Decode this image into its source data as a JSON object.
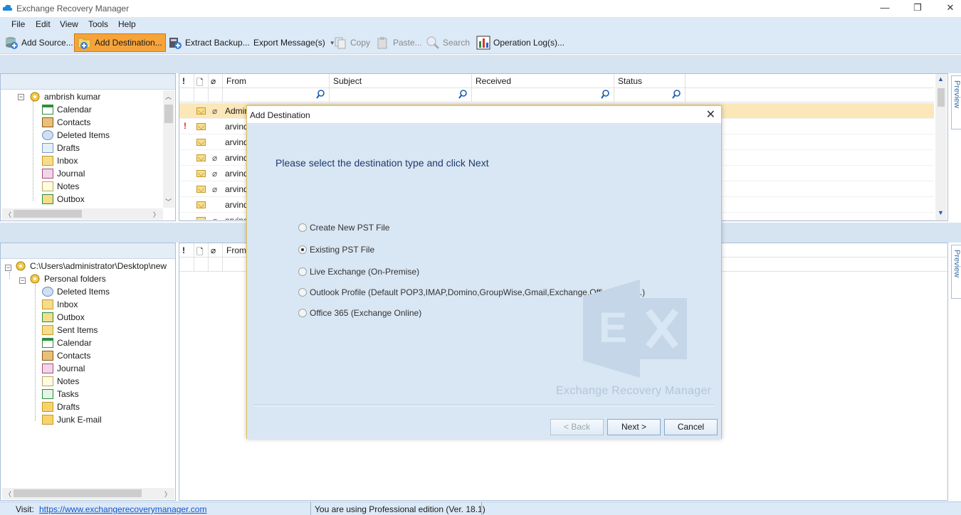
{
  "app": {
    "title": "Exchange Recovery Manager",
    "window_controls": {
      "minimize": "—",
      "maximize": "❐",
      "close": "✕"
    }
  },
  "menu": [
    "File",
    "Edit",
    "View",
    "Tools",
    "Help"
  ],
  "toolbar": {
    "add_source": "Add Source...",
    "add_destination": "Add Destination...",
    "extract_backup": "Extract Backup...",
    "export_messages": "Export Message(s)",
    "copy": "Copy",
    "paste": "Paste...",
    "search": "Search",
    "operation_logs": "Operation Log(s)..."
  },
  "source_tree": {
    "root": "ambrish kumar",
    "items": [
      "Calendar",
      "Contacts",
      "Deleted Items",
      "Drafts",
      "Inbox",
      "Journal",
      "Notes",
      "Outbox"
    ]
  },
  "dest_tree": {
    "root": "C:\\Users\\administrator\\Desktop\\new",
    "folder": "Personal folders",
    "items": [
      "Deleted Items",
      "Inbox",
      "Outbox",
      "Sent Items",
      "Calendar",
      "Contacts",
      "Journal",
      "Notes",
      "Tasks",
      "Drafts",
      "Junk E-mail"
    ]
  },
  "grid": {
    "columns": [
      "From",
      "Subject",
      "Received",
      "Status"
    ],
    "rows": [
      "Admini",
      "arvind",
      "arvind",
      "arvind",
      "arvind",
      "arvind",
      "arvind",
      "arvind"
    ]
  },
  "lower_grid": {
    "columns": [
      "From"
    ]
  },
  "preview_label": "Preview",
  "status": {
    "visit_label": "Visit:",
    "url": "https://www.exchangerecoverymanager.com",
    "edition": "You are using Professional edition (Ver. 18.1)"
  },
  "dialog": {
    "title": "Add Destination",
    "prompt": "Please select the destination type and click Next",
    "options": [
      "Create New PST File",
      "Existing PST File",
      "Live Exchange (On-Premise)",
      "Outlook Profile (Default POP3,IMAP,Domino,GroupWise,Gmail,Exchange,Office365 etc.)",
      "Office 365 (Exchange Online)"
    ],
    "selected_index": 1,
    "watermark": "Exchange Recovery Manager",
    "back": "< Back",
    "next": "Next >",
    "cancel": "Cancel"
  },
  "colors": {
    "accent": "#f6a43a",
    "chrome": "#dce9f7",
    "dialog_bg": "#d9e6f3",
    "link": "#1155cc"
  }
}
